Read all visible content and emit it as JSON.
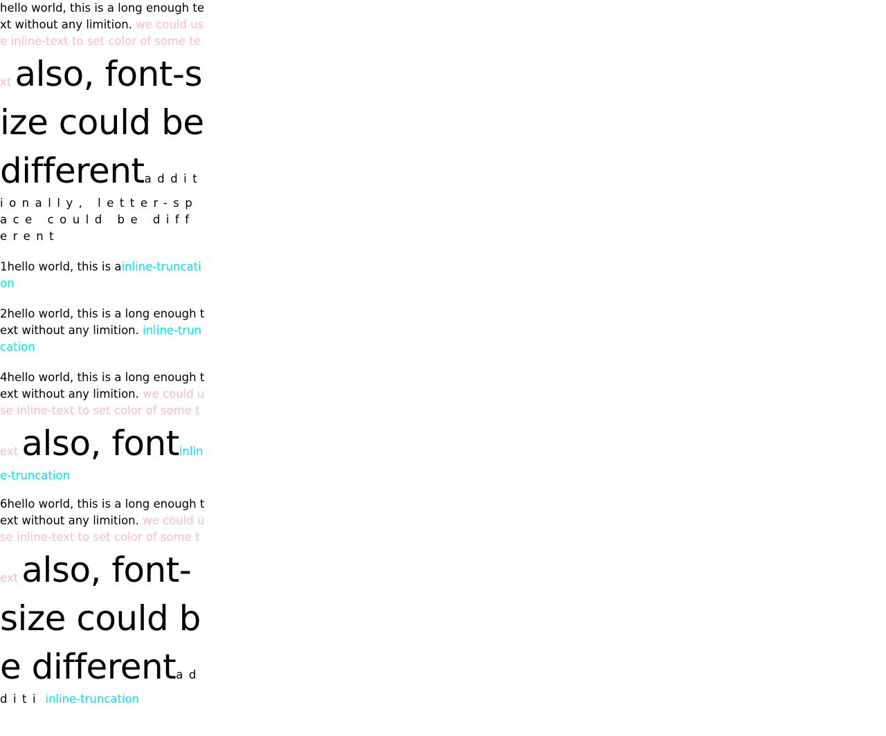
{
  "colors": {
    "pink": "#f6bcc8",
    "cyan": "#00e4ee",
    "text": "#000000",
    "background": "#ffffff"
  },
  "p0": {
    "text": "hello world, this is a long enough text without any limition.",
    "pink": "we could use inline-text to set color of some text",
    "big": "also, font-size could be different",
    "spaced": "additionally, letter-space could be different"
  },
  "p1": {
    "text": "1hello world, this is a",
    "trunc": "inline-truncation"
  },
  "p2": {
    "text": "2hello world, this is a long enough text without any limition.",
    "trunc": "inline-truncation"
  },
  "p4": {
    "text": "4hello world, this is a long enough text without any limition.",
    "pink": "we could use inline-text to set color of some text",
    "big": "also, font",
    "trunc": "inline-truncation"
  },
  "p6": {
    "text": "6hello world, this is a long enough text without any limition.",
    "pink": "we could use inline-text to set color of some text",
    "big": "also, font-size could be different",
    "spaced": "additi",
    "trunc": "inline-truncation"
  }
}
